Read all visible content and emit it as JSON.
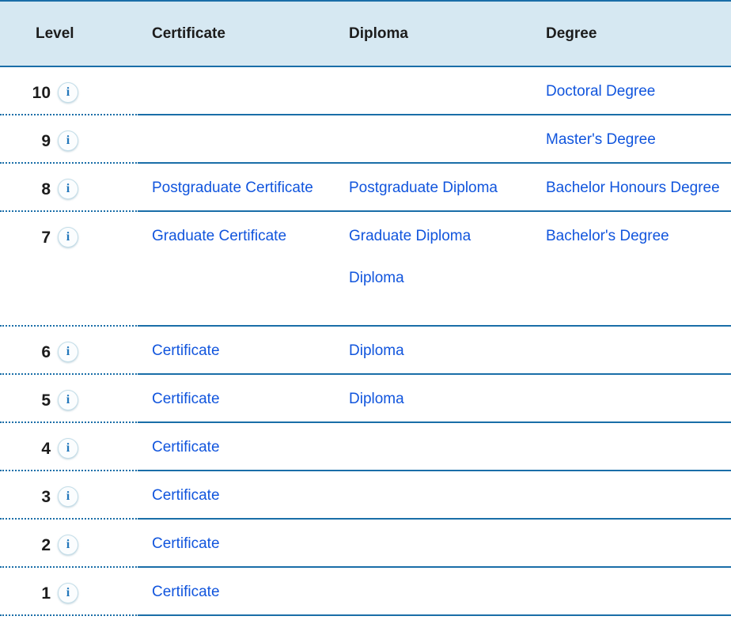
{
  "table": {
    "columns": [
      {
        "key": "level",
        "label": "Level"
      },
      {
        "key": "cert",
        "label": "Certificate"
      },
      {
        "key": "diploma",
        "label": "Diploma"
      },
      {
        "key": "degree",
        "label": "Degree"
      }
    ],
    "info_icon_glyph": "i",
    "info_icon_name": "info-icon",
    "colors": {
      "header_background": "#d6e8f2",
      "header_text": "#1c1c1c",
      "border": "#1a6ea8",
      "link": "#1155dd",
      "icon_text": "#2277bb",
      "icon_border": "#c3dde8",
      "row_background": "#ffffff"
    },
    "rows": [
      {
        "level": "10",
        "certificate": [],
        "diploma": [],
        "degree": [
          "Doctoral Degree"
        ]
      },
      {
        "level": "9",
        "certificate": [],
        "diploma": [],
        "degree": [
          "Master's Degree"
        ]
      },
      {
        "level": "8",
        "certificate": [
          "Postgraduate Certificate"
        ],
        "diploma": [
          "Postgraduate Diploma"
        ],
        "degree": [
          "Bachelor Honours Degree"
        ]
      },
      {
        "level": "7",
        "certificate": [
          "Graduate Certificate"
        ],
        "diploma": [
          "Graduate Diploma",
          "Diploma"
        ],
        "degree": [
          "Bachelor's Degree"
        ]
      },
      {
        "level": "6",
        "certificate": [
          "Certificate"
        ],
        "diploma": [
          "Diploma"
        ],
        "degree": []
      },
      {
        "level": "5",
        "certificate": [
          "Certificate"
        ],
        "diploma": [
          "Diploma"
        ],
        "degree": []
      },
      {
        "level": "4",
        "certificate": [
          "Certificate"
        ],
        "diploma": [],
        "degree": []
      },
      {
        "level": "3",
        "certificate": [
          "Certificate"
        ],
        "diploma": [],
        "degree": []
      },
      {
        "level": "2",
        "certificate": [
          "Certificate"
        ],
        "diploma": [],
        "degree": []
      },
      {
        "level": "1",
        "certificate": [
          "Certificate"
        ],
        "diploma": [],
        "degree": []
      }
    ]
  }
}
